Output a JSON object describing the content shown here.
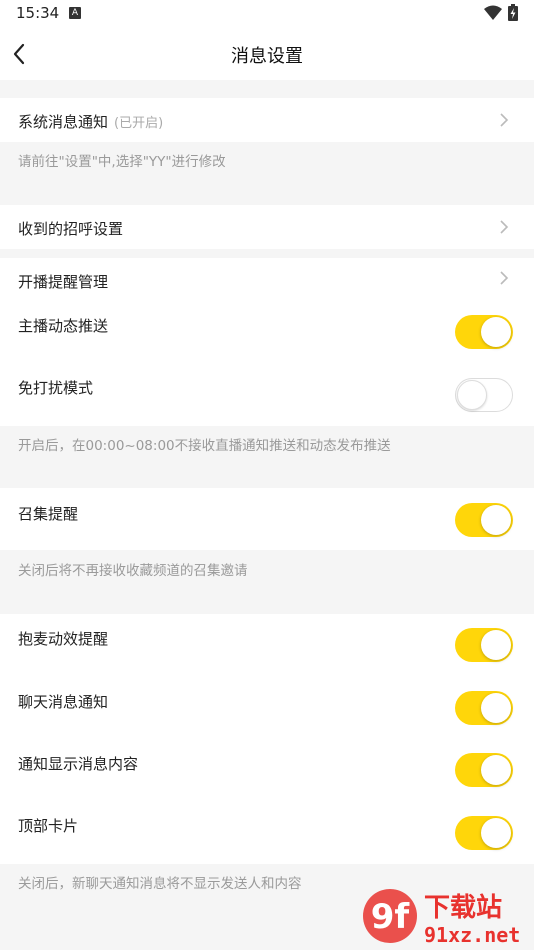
{
  "status_bar": {
    "time": "15:34",
    "notification_glyph": "A"
  },
  "header": {
    "title": "消息设置"
  },
  "sections": {
    "system": {
      "label": "系统消息通知",
      "status": "(已开启)",
      "note": "请前往\"设置\"中,选择\"YY\"进行修改"
    },
    "greeting": {
      "label": "收到的招呼设置"
    },
    "live": {
      "reminder_label": "开播提醒管理",
      "dynamic_label": "主播动态推送",
      "dynamic_on": true,
      "dnd_label": "免打扰模式",
      "dnd_on": false,
      "note": "开启后，在00:00~08:00不接收直播通知推送和动态发布推送"
    },
    "summon": {
      "label": "召集提醒",
      "on": true,
      "note": "关闭后将不再接收收藏频道的召集邀请"
    },
    "chat": {
      "mic_label": "抱麦动效提醒",
      "mic_on": true,
      "chat_label": "聊天消息通知",
      "chat_on": true,
      "content_label": "通知显示消息内容",
      "content_on": true,
      "card_label": "顶部卡片",
      "card_on": true,
      "note": "关闭后，新聊天通知消息将不显示发送人和内容"
    }
  },
  "watermark": {
    "brand": "下载站",
    "domain": "91xz.net",
    "logo": "9f"
  },
  "colors": {
    "toggle_on": "#ffd60a",
    "background": "#f5f5f5",
    "note_text": "#9a9a9a"
  }
}
